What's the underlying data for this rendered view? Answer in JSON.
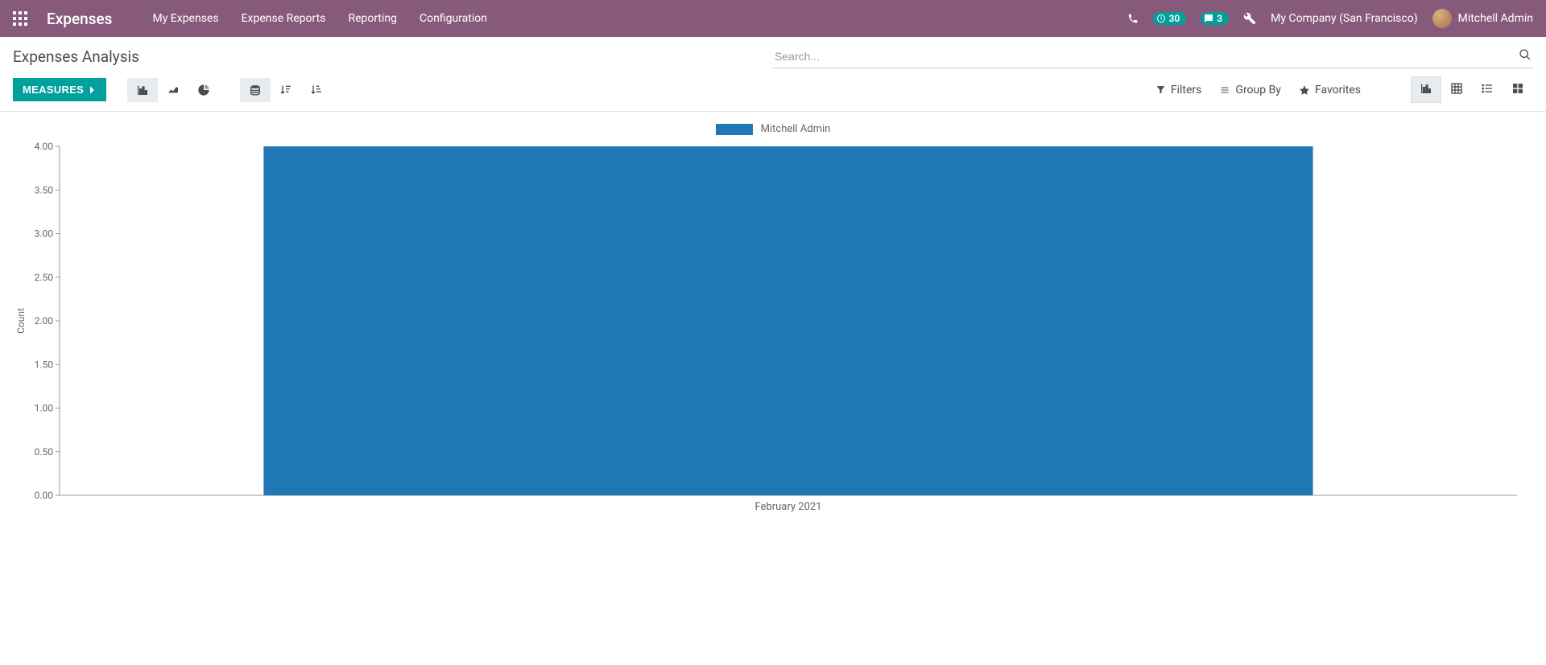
{
  "navbar": {
    "brand": "Expenses",
    "links": [
      "My Expenses",
      "Expense Reports",
      "Reporting",
      "Configuration"
    ],
    "activity_count": "30",
    "message_count": "3",
    "company": "My Company (San Francisco)",
    "user_name": "Mitchell Admin"
  },
  "page": {
    "title": "Expenses Analysis",
    "search_placeholder": "Search..."
  },
  "toolbar": {
    "measures_label": "MEASURES",
    "filters_label": "Filters",
    "groupby_label": "Group By",
    "favorites_label": "Favorites"
  },
  "chart_data": {
    "type": "bar",
    "categories": [
      "February 2021"
    ],
    "series": [
      {
        "name": "Mitchell Admin",
        "values": [
          4.0
        ],
        "color": "#1f77b4"
      }
    ],
    "ylabel": "Count",
    "xlabel": "",
    "ylim": [
      0,
      4
    ],
    "yticks": [
      "0.00",
      "0.50",
      "1.00",
      "1.50",
      "2.00",
      "2.50",
      "3.00",
      "3.50",
      "4.00"
    ]
  }
}
